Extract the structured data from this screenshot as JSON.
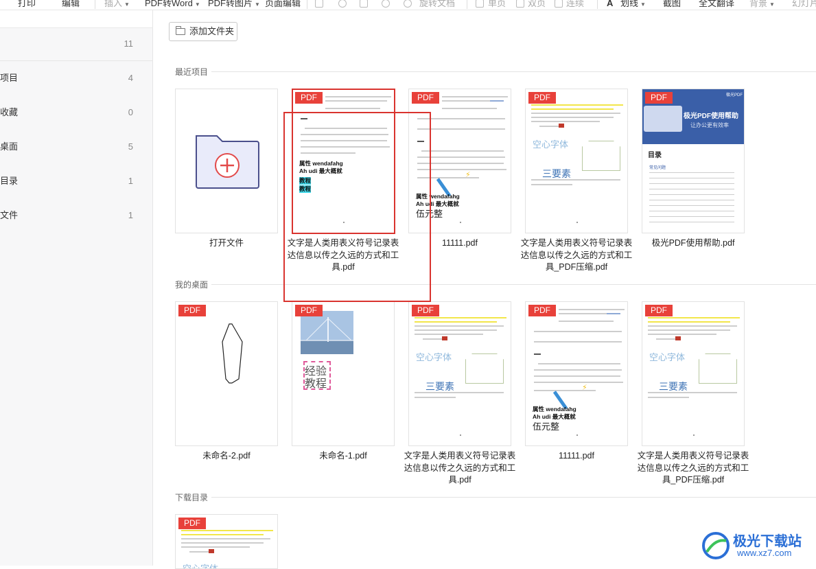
{
  "toolbar": {
    "items": [
      "打印",
      "编辑",
      "插入",
      "PDF转Word",
      "PDF转图片",
      "页面编辑",
      "旋转文档",
      "单页",
      "双页",
      "连续",
      "划线",
      "截图",
      "全文翻译",
      "背景",
      "幻灯片"
    ]
  },
  "sidebar": {
    "top_count": "11",
    "items": [
      {
        "label": "项目",
        "count": "4"
      },
      {
        "label": "收藏",
        "count": "0"
      },
      {
        "label": "桌面",
        "count": "5"
      },
      {
        "label": "目录",
        "count": "1"
      },
      {
        "label": "文件",
        "count": "1"
      }
    ]
  },
  "main": {
    "add_folder": "添加文件夹",
    "badge": "PDF",
    "sections": [
      {
        "title": "最近项目",
        "files": [
          "打开文件",
          "文字是人类用表义符号记录表达信息以传之久远的方式和工具.pdf",
          "11111.pdf",
          "文字是人类用表义符号记录表达信息以传之久远的方式和工具_PDF压缩.pdf",
          "极光PDF使用帮助.pdf"
        ]
      },
      {
        "title": "我的桌面",
        "files": [
          "未命名-2.pdf",
          "未命名-1.pdf",
          "文字是人类用表义符号记录表达信息以传之久远的方式和工具.pdf",
          "11111.pdf",
          "文字是人类用表义符号记录表达信息以传之久远的方式和工具_PDF压缩.pdf"
        ]
      },
      {
        "title": "下载目录",
        "files": []
      }
    ]
  },
  "thumb": {
    "bold1": "属性 wendafahg",
    "bold2": "Ah udi 最大概就",
    "hl1": "教程",
    "hl2": "教程",
    "hollow": "空心字体",
    "three": "三要素",
    "hand": "伍元整",
    "jingyan1": "经验",
    "jingyan2": "教程",
    "help_title": "极光PDF使用帮助",
    "help_sub": "让办公更有效率",
    "help_toc": "目录",
    "help_faq": "常见问题",
    "help_brand": "极光PDF"
  },
  "watermark": {
    "text": "极光下载站",
    "url": "www.xz7.com"
  },
  "colors": {
    "accent_red": "#e8413a",
    "highlight_cyan": "#3fd7e8",
    "help_blue": "#3a5fa8"
  }
}
